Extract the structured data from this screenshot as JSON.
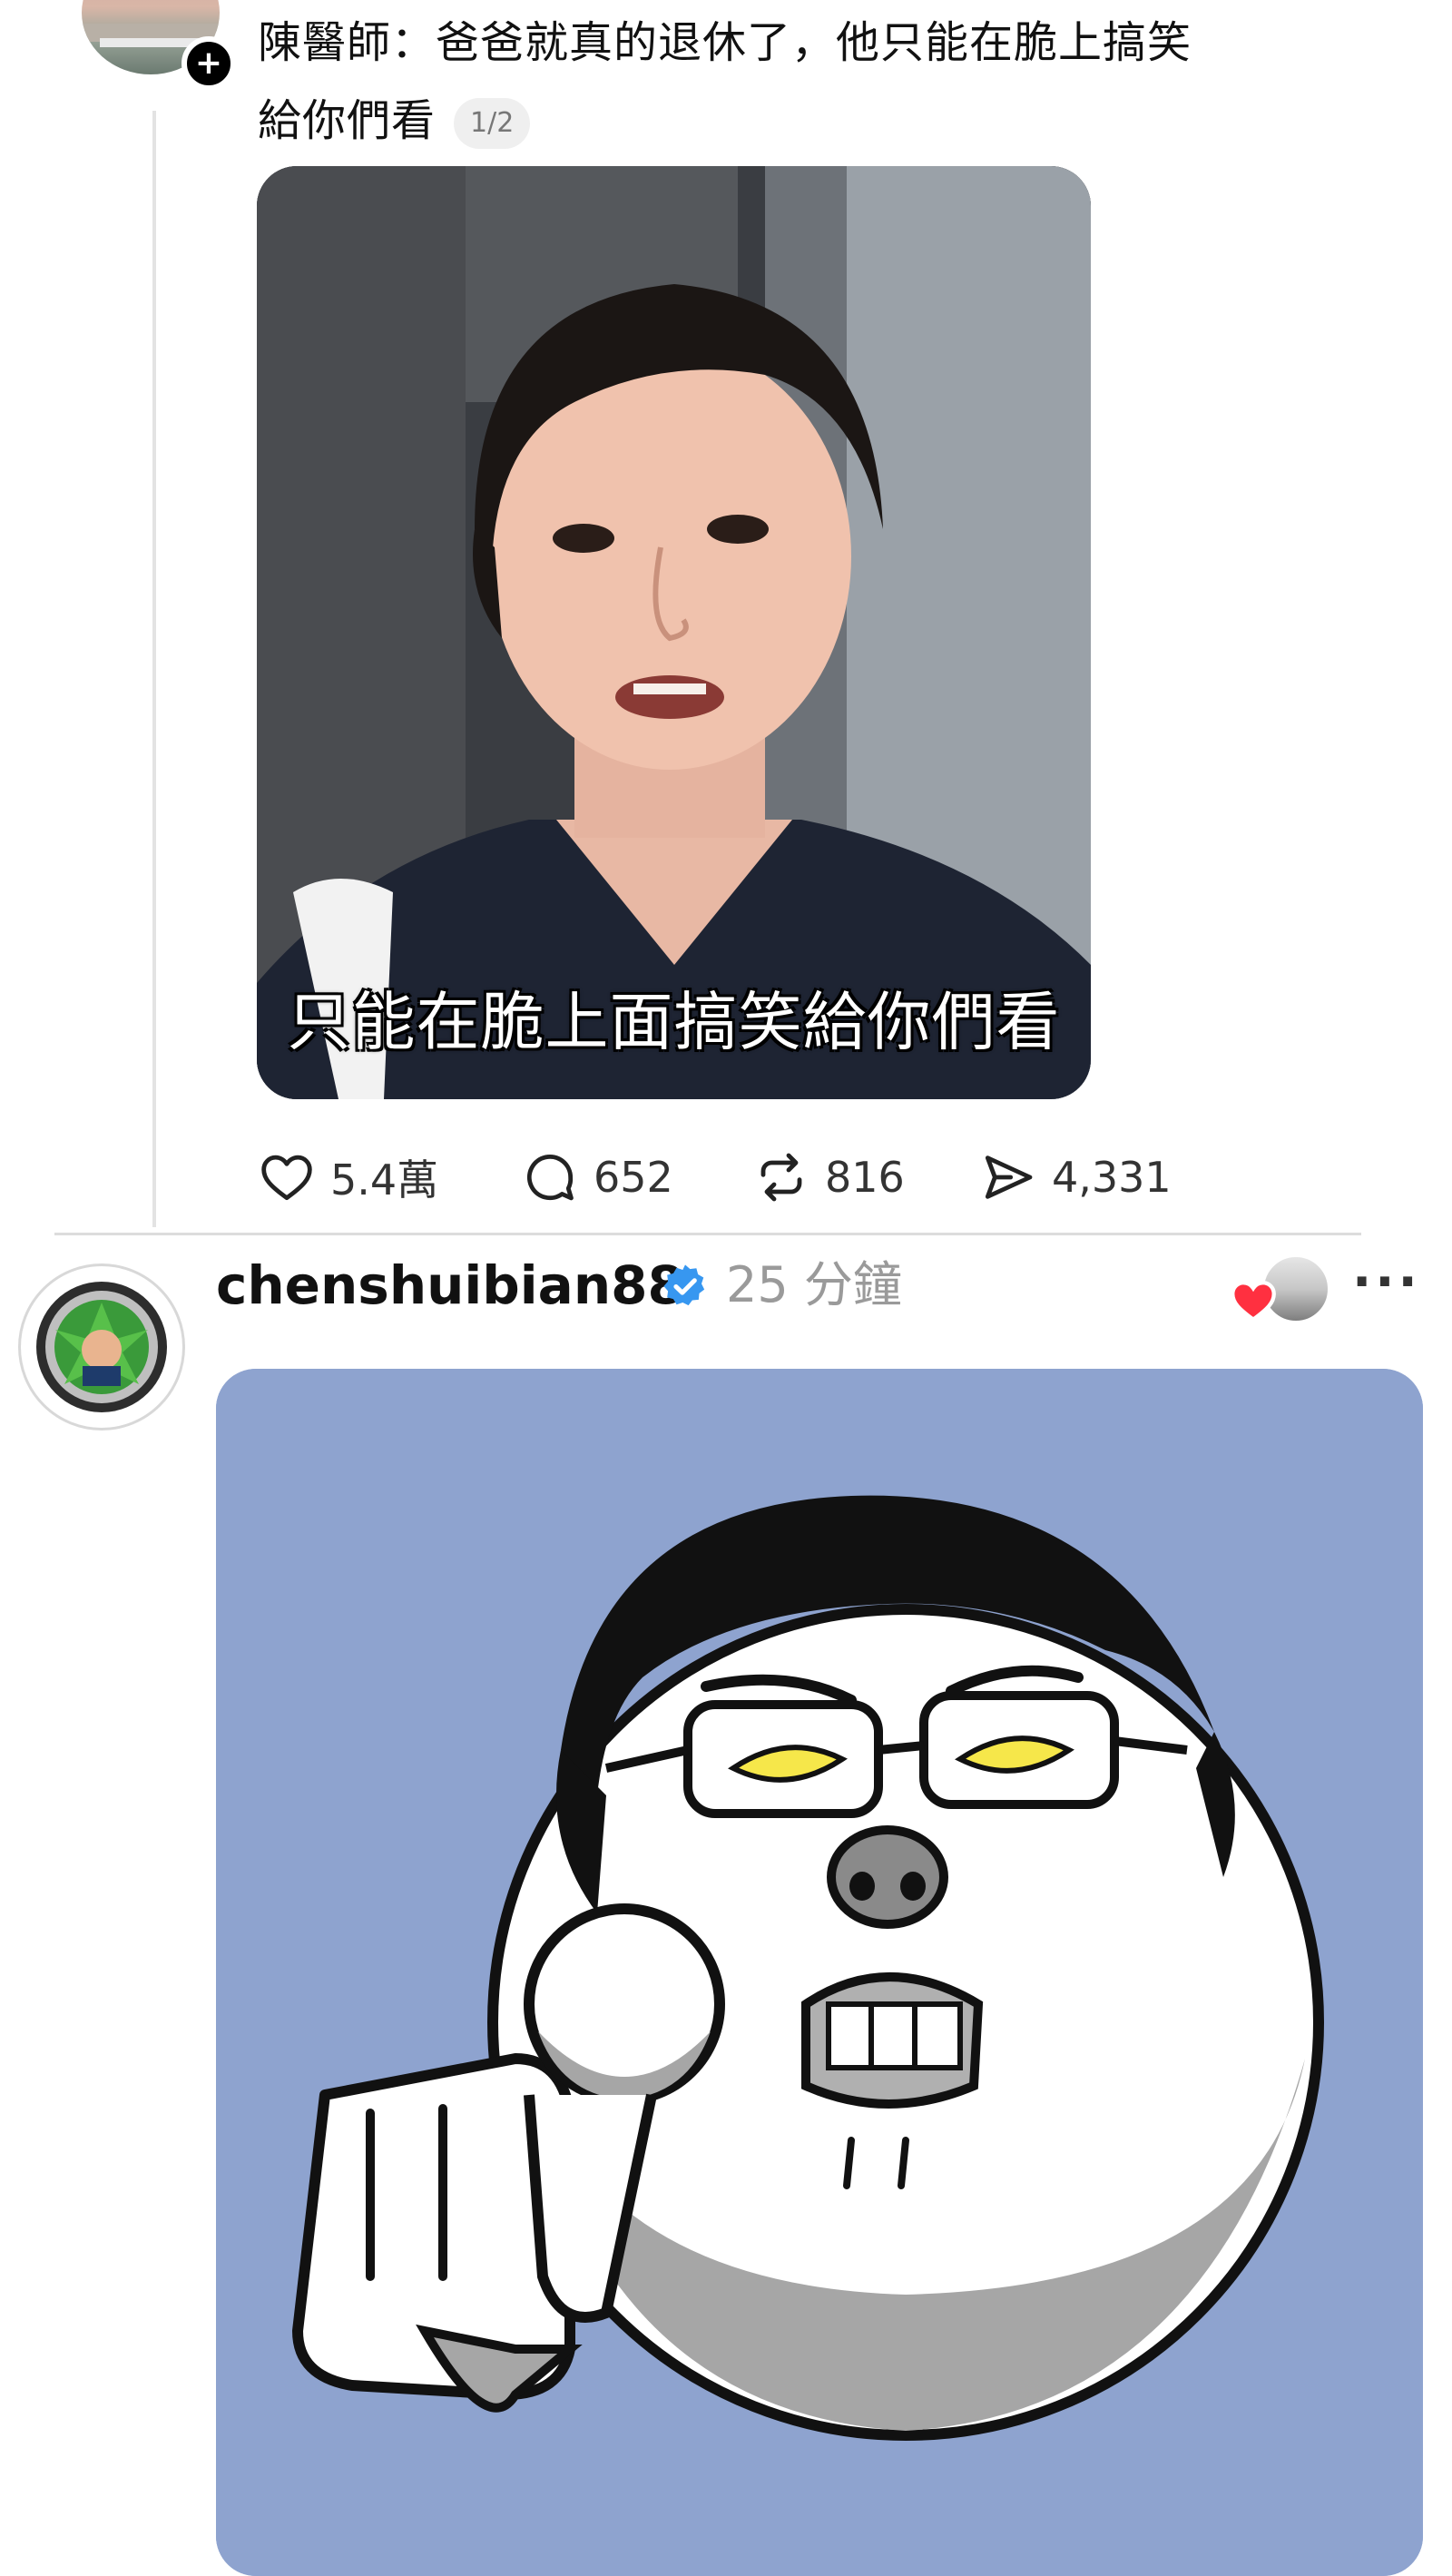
{
  "post1": {
    "text_line1": "陳醫師：爸爸就真的退休了，他只能在脆上搞笑",
    "text_line2": "給你們看",
    "page_indicator": "1/2",
    "video_caption": "只能在脆上面搞笑給你們看",
    "actions": {
      "likes": "5.4萬",
      "comments": "652",
      "reposts": "816",
      "shares": "4,331"
    }
  },
  "post2": {
    "username": "chenshuibian88",
    "time_ago": "25 分鐘",
    "more_label": "···"
  },
  "colors": {
    "verified": "#3797f0",
    "like_heart": "#ff3040",
    "sticker_bg": "#8ea3cf"
  },
  "icons": [
    "plus-icon",
    "heart-icon",
    "comment-icon",
    "repost-icon",
    "share-icon",
    "verified-icon",
    "more-icon"
  ]
}
